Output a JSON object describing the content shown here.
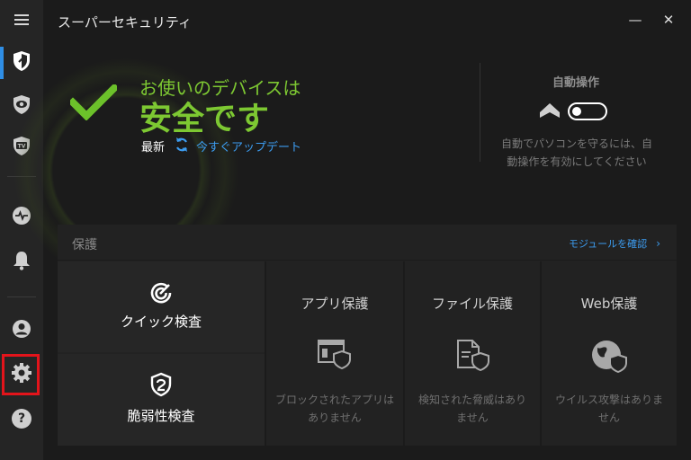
{
  "app": {
    "title": "スーパーセキュリティ",
    "window_controls": {
      "minimize": "—",
      "close": "✕"
    }
  },
  "sidebar": {
    "items": [
      {
        "name": "menu",
        "icon": "hamburger-icon"
      },
      {
        "name": "protection",
        "icon": "shield-icon",
        "active": true
      },
      {
        "name": "privacy",
        "icon": "eye-icon"
      },
      {
        "name": "utilities",
        "icon": "tv-shield-icon"
      },
      {
        "name": "activity",
        "icon": "pulse-icon"
      },
      {
        "name": "notifications",
        "icon": "bell-icon"
      },
      {
        "name": "account",
        "icon": "user-icon"
      },
      {
        "name": "settings",
        "icon": "gear-icon",
        "highlighted": true
      },
      {
        "name": "help",
        "icon": "help-icon",
        "glyph": "?"
      }
    ],
    "highlight_color": "#e3141b"
  },
  "status": {
    "headline_small": "お使いのデバイスは",
    "headline_large": "安全です",
    "latest_label": "最新",
    "update_link": "今すぐアップデート",
    "accent_color": "#7dc832",
    "link_color": "#3c9cf0"
  },
  "autopilot": {
    "title": "自動操作",
    "enabled": false,
    "description": "自動でパソコンを守るには、自動操作を有効にしてください"
  },
  "protection": {
    "title": "保護",
    "modules_link": "モジュールを確認",
    "scans": [
      {
        "label": "クイック検査",
        "icon": "quick-scan-icon"
      },
      {
        "label": "脆弱性検査",
        "icon": "vulnerability-shield-icon"
      }
    ],
    "features": [
      {
        "title": "アプリ保護",
        "description": "ブロックされたアプリはありません",
        "icon": "app-shield-icon"
      },
      {
        "title": "ファイル保護",
        "description": "検知された脅威はありません",
        "icon": "file-shield-icon"
      },
      {
        "title": "Web保護",
        "description": "ウイルス攻撃はありません",
        "icon": "globe-shield-icon"
      }
    ]
  }
}
